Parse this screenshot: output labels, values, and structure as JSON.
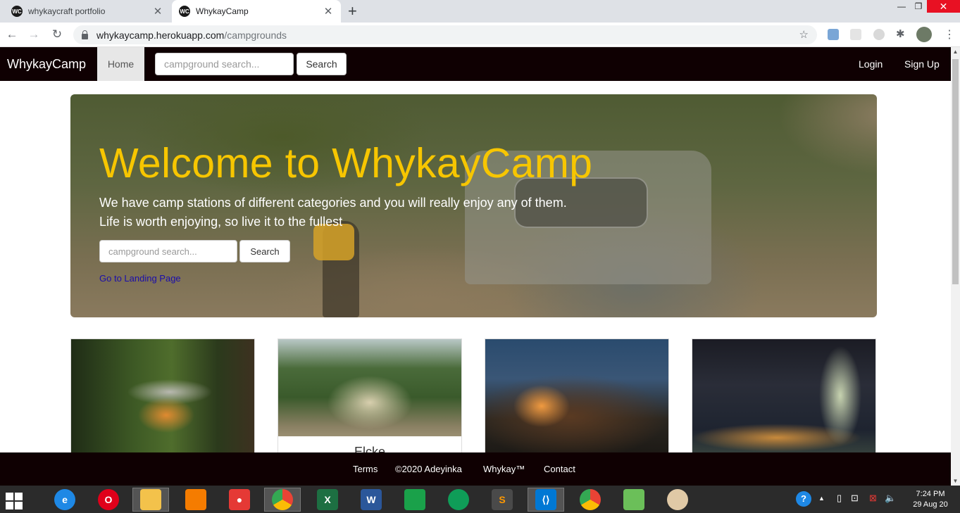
{
  "browser": {
    "tabs": [
      {
        "favicon": "WC",
        "title": "whykaycraft portfolio",
        "active": false
      },
      {
        "favicon": "WC",
        "title": "WhykayCamp",
        "active": true
      }
    ],
    "url_host": "whykaycamp.herokuapp.com",
    "url_path": "/campgrounds"
  },
  "navbar": {
    "brand": "WhykayCamp",
    "home": "Home",
    "search_placeholder": "campground search...",
    "search_button": "Search",
    "login": "Login",
    "signup": "Sign Up"
  },
  "hero": {
    "title": "Welcome to WhykayCamp",
    "lead_line1": "We have camp stations of different categories and you will really enjoy any of them.",
    "lead_line2": "Life is worth enjoying, so live it to the fullest",
    "search_placeholder": "campground search...",
    "search_button": "Search",
    "landing_link": "Go to Landing Page"
  },
  "cards": [
    {
      "caption": ""
    },
    {
      "caption": "Elcke"
    },
    {
      "caption": ""
    },
    {
      "caption": ""
    }
  ],
  "footer": {
    "terms": "Terms",
    "copyright": "©2020 Adeyinka",
    "trademark": "Whykay™",
    "contact": "Contact"
  },
  "taskbar": {
    "time": "7:24 PM",
    "date": "29 Aug 20"
  },
  "colors": {
    "nav_bg": "#0f0002",
    "hero_title": "#f7c600",
    "link": "#1a0dab"
  }
}
